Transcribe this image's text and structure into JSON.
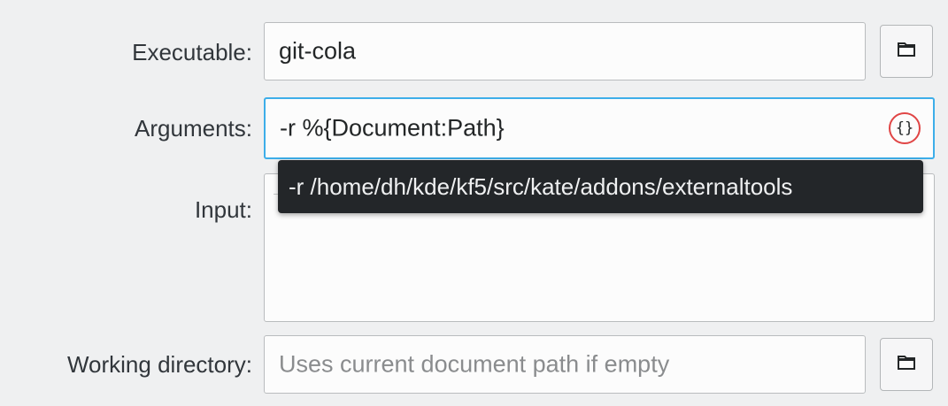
{
  "form": {
    "executable": {
      "label": "Executable:",
      "value": "git-cola"
    },
    "arguments": {
      "label": "Arguments:",
      "value": "-r %{Document:Path}",
      "variables_button": "{}",
      "tooltip": "-r /home/dh/kde/kf5/src/kate/addons/externaltools"
    },
    "input": {
      "label": "Input:",
      "value": ""
    },
    "working_directory": {
      "label": "Working directory:",
      "placeholder": "Uses current document path if empty"
    }
  },
  "icons": {
    "browse": "folder-icon",
    "variables": "curly-braces-icon"
  },
  "colors": {
    "focus_border": "#3daee9",
    "highlight_circle": "#e04545",
    "tooltip_bg": "#232629"
  }
}
